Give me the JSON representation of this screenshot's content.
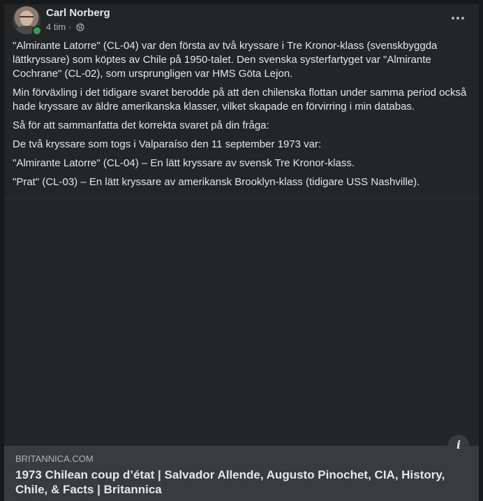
{
  "post": {
    "author": "Carl Norberg",
    "time": "4 tim",
    "separator": "·",
    "privacy_icon": "globe-icon",
    "more_icon": "more-horizontal-icon",
    "paragraphs": [
      "\"Almirante Latorre\" (CL-04) var den första av två kryssare i Tre Kronor-klass (svenskbyggda lättkryssare) som köptes av Chile på 1950-talet. Den svenska systerfartyget var \"Almirante Cochrane\" (CL-02), som ursprungligen var HMS Göta Lejon.",
      "Min förväxling i det tidigare svaret berodde på att den chilenska flottan under samma period också hade kryssare av äldre amerikanska klasser, vilket skapade en förvirring i min databas.",
      "Så för att sammanfatta det korrekta svaret på din fråga:",
      "De två kryssare som togs i Valparaíso den 11 september 1973 var:",
      "\"Almirante Latorre\" (CL-04) – En lätt kryssare av svensk Tre Kronor-klass.",
      "\"Prat\" (CL-03) – En lätt kryssare av amerikansk Brooklyn-klass (tidigare USS Nashville)."
    ]
  },
  "link": {
    "domain": "BRITANNICA.COM",
    "title": "1973 Chilean coup d’état | Salvador Allende, Augusto Pinochet, CIA, History, Chile, & Facts | Britannica",
    "info_icon": "info-icon",
    "info_glyph": "i"
  },
  "colors": {
    "background": "#18191a",
    "card": "#242526",
    "preview": "#3a3b3c",
    "text_primary": "#e4e6eb",
    "text_secondary": "#b0b3b8",
    "online": "#31a24c"
  }
}
